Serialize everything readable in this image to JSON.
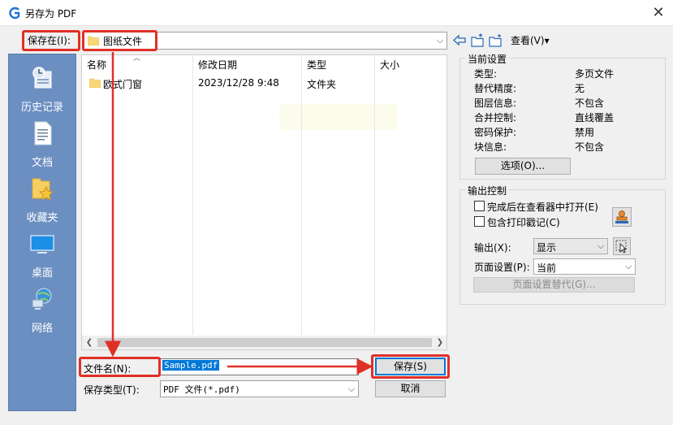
{
  "window": {
    "title": "另存为 PDF",
    "close_glyph": "✕"
  },
  "location": {
    "label": "保存在(I):",
    "value": "图纸文件",
    "arrow": "⌵"
  },
  "toolbar": {
    "view_label": "查看(V)▾"
  },
  "places": [
    {
      "label": "历史记录",
      "icon": "history-icon"
    },
    {
      "label": "文档",
      "icon": "document-icon"
    },
    {
      "label": "收藏夹",
      "icon": "favorites-icon"
    },
    {
      "label": "桌面",
      "icon": "desktop-icon"
    },
    {
      "label": "网络",
      "icon": "network-icon"
    }
  ],
  "file_list": {
    "columns": [
      "名称",
      "修改日期",
      "类型",
      "大小"
    ],
    "rows": [
      {
        "name": "欧式门窗",
        "modified": "2023/12/28 9:48",
        "type": "文件夹",
        "size": ""
      }
    ]
  },
  "filename": {
    "label": "文件名(N):",
    "value": "Sample.pdf"
  },
  "filetype": {
    "label": "保存类型(T):",
    "value": "PDF 文件(*.pdf)"
  },
  "buttons": {
    "save": "保存(S)",
    "cancel": "取消",
    "options": "选项(O)...",
    "page_override": "页面设置替代(G)..."
  },
  "current_settings": {
    "title": "当前设置",
    "items": [
      {
        "key": "类型:",
        "value": "多页文件"
      },
      {
        "key": "替代精度:",
        "value": "无"
      },
      {
        "key": "图层信息:",
        "value": "不包含"
      },
      {
        "key": "合并控制:",
        "value": "直线覆盖"
      },
      {
        "key": "密码保护:",
        "value": "禁用"
      },
      {
        "key": "块信息:",
        "value": "不包含"
      }
    ]
  },
  "output_control": {
    "title": "输出控制",
    "open_in_viewer": "完成后在查看器中打开(E)",
    "include_stamp": "包含打印戳记(C)",
    "output_label": "输出(X):",
    "output_value": "显示",
    "page_setup_label": "页面设置(P):",
    "page_setup_value": "当前"
  },
  "colors": {
    "accent": "#0078d7",
    "annotation": "#e03026",
    "places_bar": "#6c8fc2"
  }
}
